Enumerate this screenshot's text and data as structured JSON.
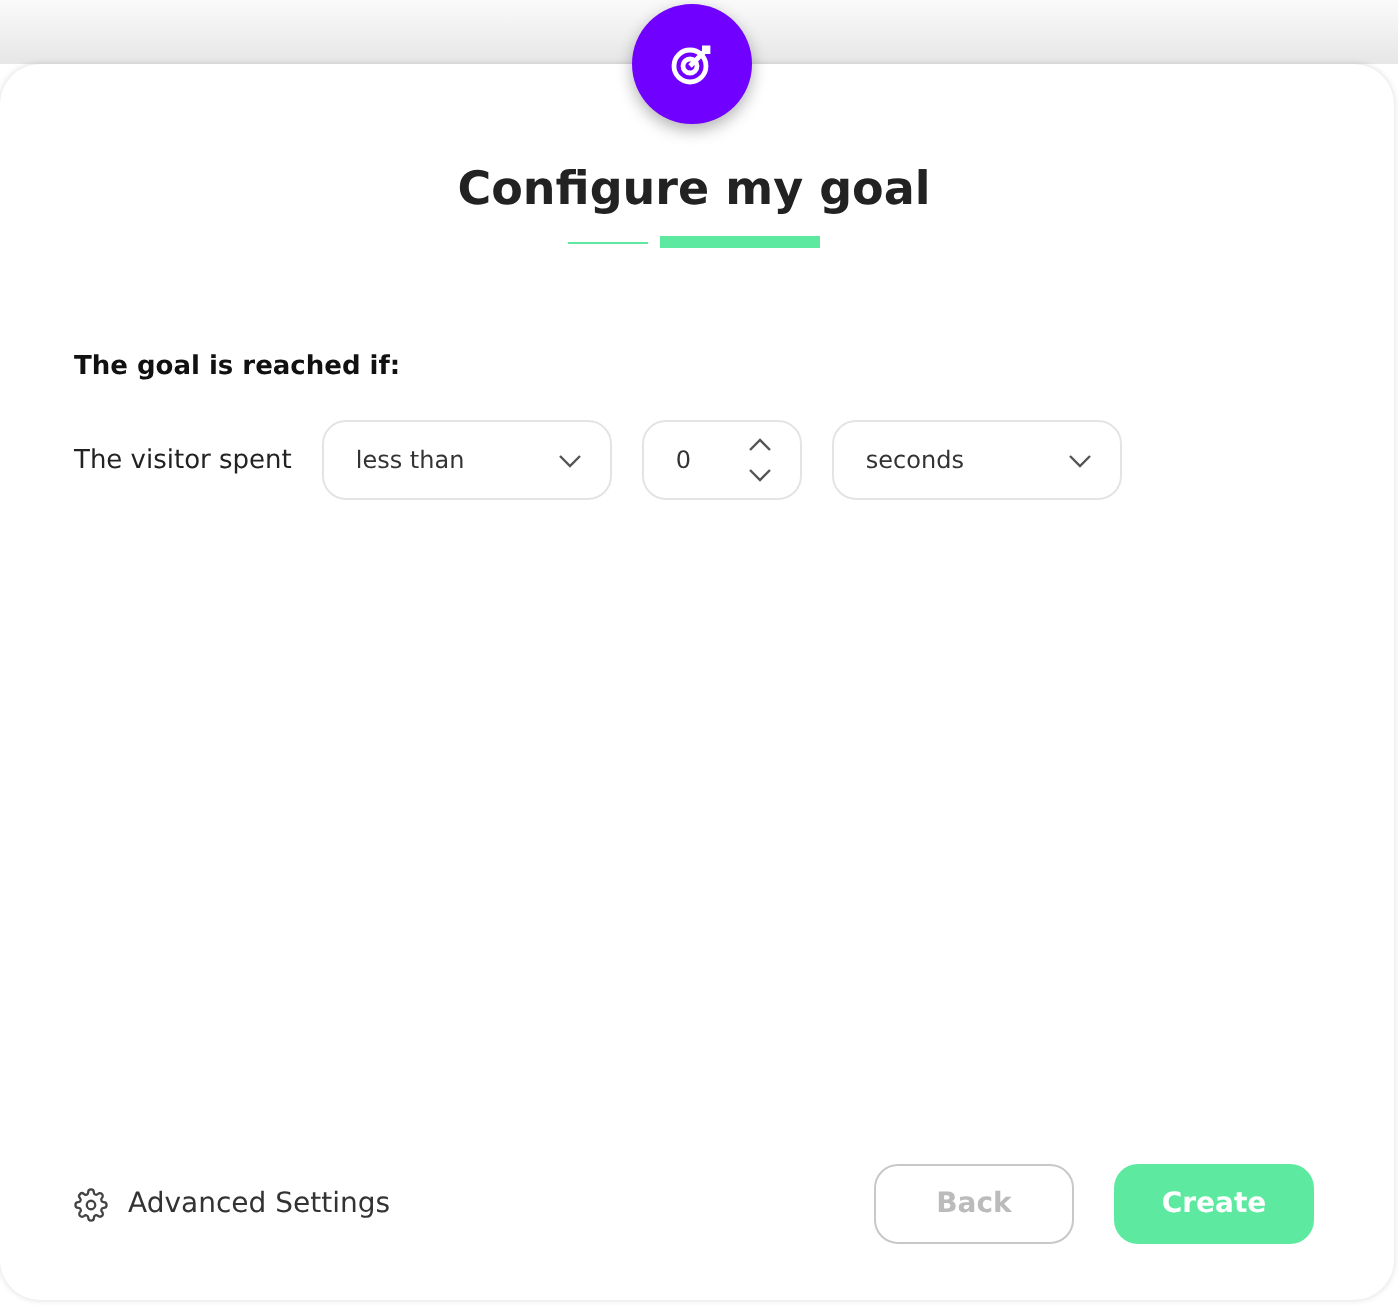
{
  "title": "Configure my goal",
  "steps": [
    {
      "selected": false
    },
    {
      "selected": true
    }
  ],
  "condition": {
    "heading": "The goal is reached if:",
    "label": "The visitor spent",
    "operator": "less than",
    "value": "0",
    "unit": "seconds"
  },
  "footer": {
    "advanced": "Advanced Settings",
    "back": {
      "label": "Back",
      "disabled": true
    },
    "create": {
      "label": "Create",
      "disabled": false
    }
  }
}
